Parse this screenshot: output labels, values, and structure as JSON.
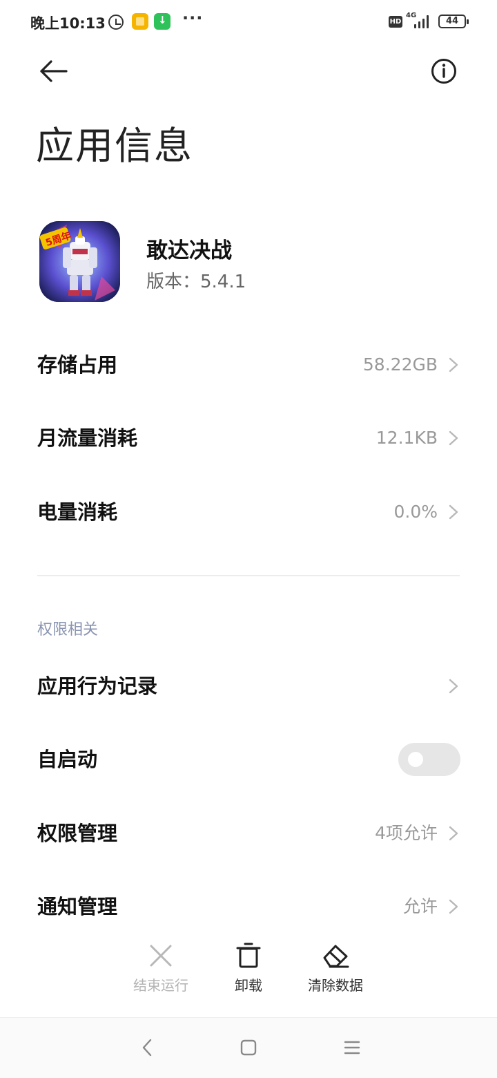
{
  "status_bar": {
    "time": "晚上10:13",
    "network": "4G",
    "hd": "HD",
    "battery": "44"
  },
  "header": {
    "title": "应用信息"
  },
  "app": {
    "name": "敢达决战",
    "version": "版本：5.4.1"
  },
  "rows": [
    {
      "label": "存储占用",
      "value": "58.22GB"
    },
    {
      "label": "月流量消耗",
      "value": "12.1KB"
    },
    {
      "label": "电量消耗",
      "value": "0.0%"
    }
  ],
  "permissions": {
    "section_title": "权限相关",
    "items": [
      {
        "label": "应用行为记录",
        "value": ""
      },
      {
        "label": "自启动",
        "toggle_on": false
      },
      {
        "label": "权限管理",
        "value": "4项允许"
      },
      {
        "label": "通知管理",
        "value": "允许"
      }
    ]
  },
  "actions": [
    {
      "label": "结束运行",
      "enabled": false
    },
    {
      "label": "卸载",
      "enabled": true
    },
    {
      "label": "清除数据",
      "enabled": true
    }
  ],
  "colors": {
    "section_title": "#8a94b2",
    "value_text": "#999999",
    "toggle_off": "#e6e6e6"
  }
}
